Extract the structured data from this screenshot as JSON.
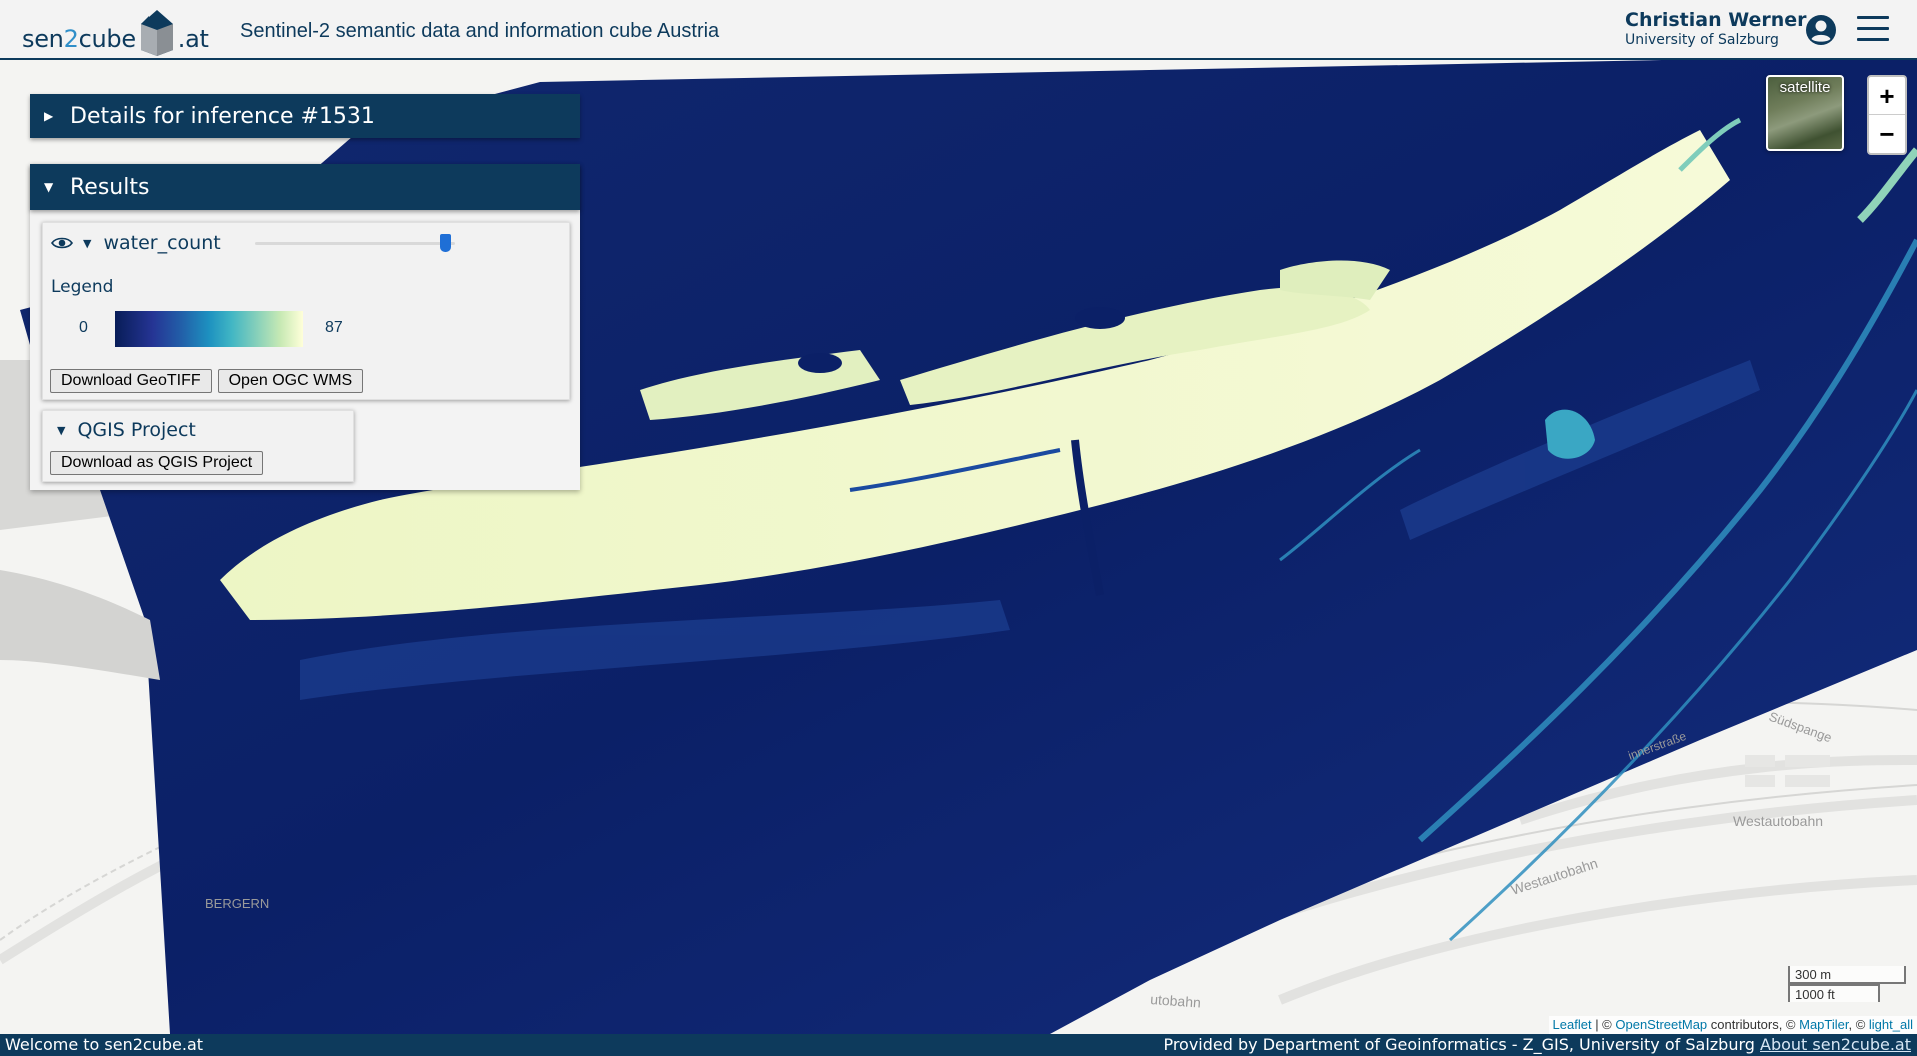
{
  "header": {
    "logo": {
      "part1": "sen",
      "part2": "2",
      "part3": "cube",
      "part4": ".at"
    },
    "subtitle": "Sentinel-2 semantic data and information cube Austria",
    "user_name": "Christian Werner",
    "user_org": "University of Salzburg",
    "icons": {
      "user": "account-circle-icon",
      "menu": "hamburger-menu-icon"
    }
  },
  "panel": {
    "details_title": "Details for inference #1531",
    "results_title": "Results",
    "layer": {
      "name": "water_count",
      "opacity": 0.95,
      "legend_title": "Legend",
      "legend_min": "0",
      "legend_max": "87",
      "download_geotiff": "Download GeoTIFF",
      "open_wms": "Open OGC WMS"
    },
    "qgis": {
      "title": "QGIS Project",
      "download": "Download as QGIS Project"
    }
  },
  "map": {
    "layer_switch_label": "satellite",
    "zoom_in": "+",
    "zoom_out": "−",
    "scale_m": "300 m",
    "scale_ft": "1000 ft",
    "labels": {
      "bergern": "BERGERN",
      "westautobahn1": "Westautobahn",
      "westautobahn2": "Westautobahn",
      "suedspange": "Südspange",
      "autobahn": "utobahn",
      "innerstrasse": "innerstraße"
    },
    "attribution": {
      "leaflet": "Leaflet",
      "osm_prefix": " | © ",
      "osm": "OpenStreetMap",
      "osm_suffix": " contributors, © ",
      "maptiler": "MapTiler",
      "sep": ", © ",
      "light_all": "light_all"
    },
    "colors": {
      "ramp_low": "#081d58",
      "ramp_mid": "#41b6c4",
      "ramp_high": "#ffffd9"
    }
  },
  "footer": {
    "welcome": "Welcome to sen2cube.at",
    "provided_by": "Provided by Department of Geoinformatics - Z_GIS, University of Salzburg ",
    "about_link": "About sen2cube.at"
  }
}
